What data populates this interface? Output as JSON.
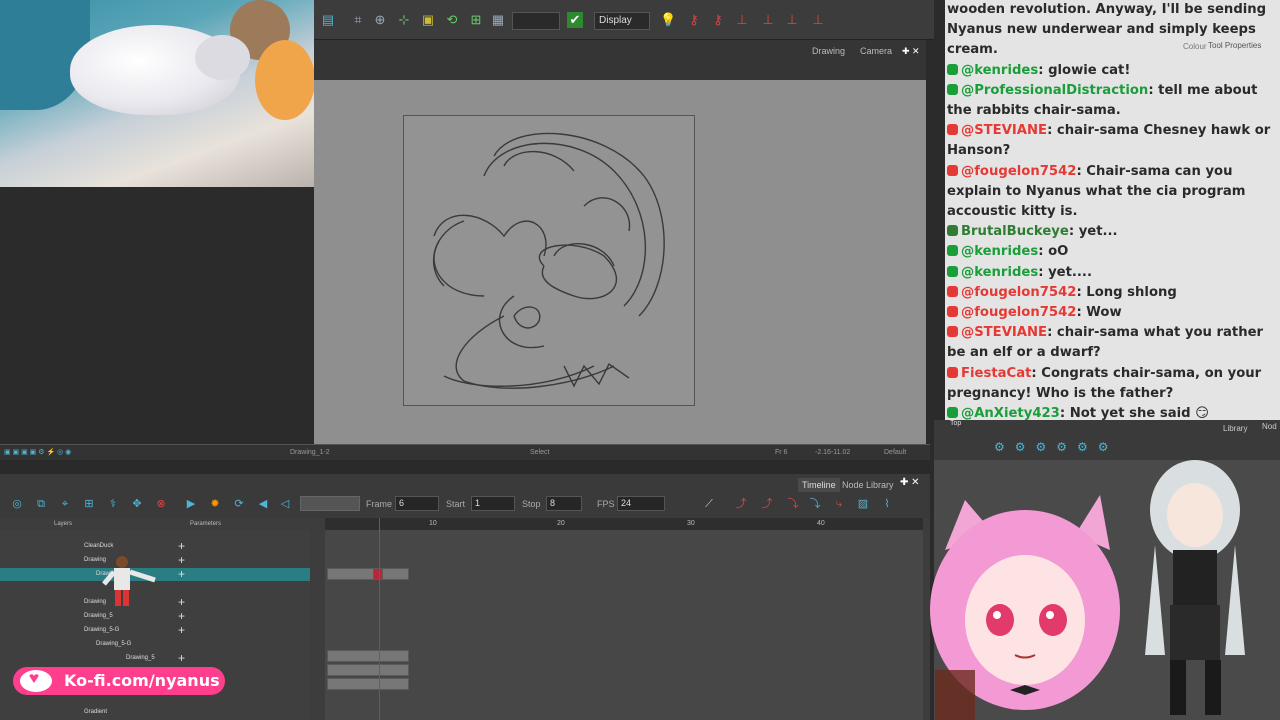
{
  "toolbar": {
    "display_dropdown": "Display"
  },
  "view_tabs": {
    "drawing": "Drawing",
    "camera": "Camera",
    "colour": "Colour",
    "tool_properties": "Tool Properties"
  },
  "status": {
    "select": "Select",
    "drawing_name": "Drawing_1-2",
    "frame_info": "Fr 6",
    "coords": "-2.16-11.02",
    "default": "Default"
  },
  "timeline": {
    "tab_timeline": "Timeline",
    "tab_node_library": "Node Library",
    "frame_label": "Frame",
    "frame_value": "6",
    "start_label": "Start",
    "start_value": "1",
    "stop_label": "Stop",
    "stop_value": "8",
    "fps_label": "FPS",
    "fps_value": "24",
    "layers_header": "Layers",
    "parameters_header": "Parameters",
    "ruler": [
      "10",
      "20",
      "30",
      "40"
    ],
    "layers": [
      "CleanDuck",
      "Drawing",
      "Drawing",
      "Drawing",
      "Drawing_5",
      "Drawing_5-G",
      "Drawing_5-G",
      "Drawing_5",
      "Drawing",
      "Gradient"
    ]
  },
  "chat": {
    "lines": [
      {
        "name": "",
        "text": "wooden revolution. Anyway, I'll be sending Nyanus new underwear and simply keeps cream.",
        "color": "#2a2a2a"
      },
      {
        "name": "@kenrides",
        "text": ": glowie cat!",
        "color": "#1a9e3a"
      },
      {
        "name": "@ProfessionalDistraction",
        "text": ": tell me about the rabbits chair-sama.",
        "color": "#1a9e3a"
      },
      {
        "name": "@STEVIANE",
        "text": ": chair-sama Chesney hawk or Hanson?",
        "color": "#e53935"
      },
      {
        "name": "@fougelon7542",
        "text": ": Chair-sama can you explain to Nyanus what the cia program accoustic kitty is.",
        "color": "#e53935"
      },
      {
        "name": "BrutalBuckeye",
        "text": ": yet...",
        "color": "#2e7d32"
      },
      {
        "name": "@kenrides",
        "text": ": oO",
        "color": "#1a9e3a"
      },
      {
        "name": "@kenrides",
        "text": ": yet....",
        "color": "#1a9e3a"
      },
      {
        "name": "@fougelon7542",
        "text": ": Long shlong",
        "color": "#e53935"
      },
      {
        "name": "@fougelon7542",
        "text": ": Wow",
        "color": "#e53935"
      },
      {
        "name": "@STEVIANE",
        "text": ": chair-sama what you rather be an elf or a dwarf?",
        "color": "#e53935"
      },
      {
        "name": "FiestaCat",
        "text": ": Congrats chair-sama, on your pregnancy! Who is the father?",
        "color": "#e53935"
      },
      {
        "name": "@AnXiety423",
        "text": ": Not yet she said 😏",
        "color": "#1a9e3a"
      }
    ]
  },
  "right_panel": {
    "library_tab": "Library",
    "node_tab": "Nod",
    "top_label": "Top"
  },
  "kofi": {
    "text": "Ko-fi.com/nyanus"
  }
}
